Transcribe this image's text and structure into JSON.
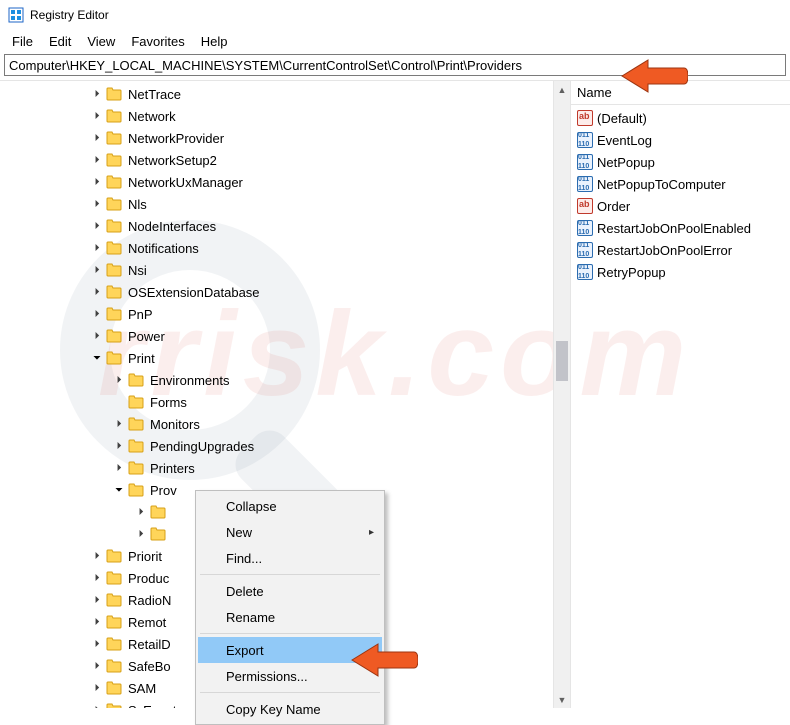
{
  "window": {
    "title": "Registry Editor"
  },
  "menu": {
    "file": "File",
    "edit": "Edit",
    "view": "View",
    "favorites": "Favorites",
    "help": "Help"
  },
  "address": {
    "path": "Computer\\HKEY_LOCAL_MACHINE\\SYSTEM\\CurrentControlSet\\Control\\Print\\Providers"
  },
  "tree": {
    "items": [
      {
        "label": "NetTrace",
        "depth": 3,
        "expandable": true
      },
      {
        "label": "Network",
        "depth": 3,
        "expandable": true
      },
      {
        "label": "NetworkProvider",
        "depth": 3,
        "expandable": true
      },
      {
        "label": "NetworkSetup2",
        "depth": 3,
        "expandable": true
      },
      {
        "label": "NetworkUxManager",
        "depth": 3,
        "expandable": true
      },
      {
        "label": "Nls",
        "depth": 3,
        "expandable": true
      },
      {
        "label": "NodeInterfaces",
        "depth": 3,
        "expandable": true
      },
      {
        "label": "Notifications",
        "depth": 3,
        "expandable": true
      },
      {
        "label": "Nsi",
        "depth": 3,
        "expandable": true
      },
      {
        "label": "OSExtensionDatabase",
        "depth": 3,
        "expandable": true
      },
      {
        "label": "PnP",
        "depth": 3,
        "expandable": true
      },
      {
        "label": "Power",
        "depth": 3,
        "expandable": true
      },
      {
        "label": "Print",
        "depth": 3,
        "expandable": true,
        "expanded": true
      },
      {
        "label": "Environments",
        "depth": 4,
        "expandable": true
      },
      {
        "label": "Forms",
        "depth": 4,
        "expandable": false
      },
      {
        "label": "Monitors",
        "depth": 4,
        "expandable": true
      },
      {
        "label": "PendingUpgrades",
        "depth": 4,
        "expandable": true
      },
      {
        "label": "Printers",
        "depth": 4,
        "expandable": true
      },
      {
        "label": "Providers",
        "depth": 4,
        "expandable": true,
        "expanded": true,
        "truncated": "Prov"
      },
      {
        "label": "",
        "depth": 5,
        "expandable": true,
        "hiddenByMenu": true
      },
      {
        "label": "",
        "depth": 5,
        "expandable": true,
        "hiddenByMenu": true
      },
      {
        "label": "Priority",
        "depth": 3,
        "expandable": true,
        "truncated": "Priorit"
      },
      {
        "label": "ProductOptions",
        "depth": 3,
        "expandable": true,
        "truncated": "Produc"
      },
      {
        "label": "RadioManagement",
        "depth": 3,
        "expandable": true,
        "truncated": "RadioN"
      },
      {
        "label": "RemoteAssistance",
        "depth": 3,
        "expandable": true,
        "truncated": "Remot"
      },
      {
        "label": "RetailDemo",
        "depth": 3,
        "expandable": true,
        "truncated": "RetailD"
      },
      {
        "label": "SafeBoot",
        "depth": 3,
        "expandable": true,
        "truncated": "SafeBo"
      },
      {
        "label": "SAM",
        "depth": 3,
        "expandable": true
      },
      {
        "label": "ScEvents",
        "depth": 3,
        "expandable": true,
        "truncated": "ScEvent"
      }
    ]
  },
  "list": {
    "header": {
      "name": "Name"
    },
    "rows": [
      {
        "name": "(Default)",
        "type": "str"
      },
      {
        "name": "EventLog",
        "type": "bin"
      },
      {
        "name": "NetPopup",
        "type": "bin"
      },
      {
        "name": "NetPopupToComputer",
        "type": "bin"
      },
      {
        "name": "Order",
        "type": "str"
      },
      {
        "name": "RestartJobOnPoolEnabled",
        "type": "bin"
      },
      {
        "name": "RestartJobOnPoolError",
        "type": "bin"
      },
      {
        "name": "RetryPopup",
        "type": "bin"
      }
    ]
  },
  "context_menu": {
    "collapse": "Collapse",
    "new": "New",
    "find": "Find...",
    "delete": "Delete",
    "rename": "Rename",
    "export": "Export",
    "permissions": "Permissions...",
    "copy_key_name": "Copy Key Name"
  }
}
